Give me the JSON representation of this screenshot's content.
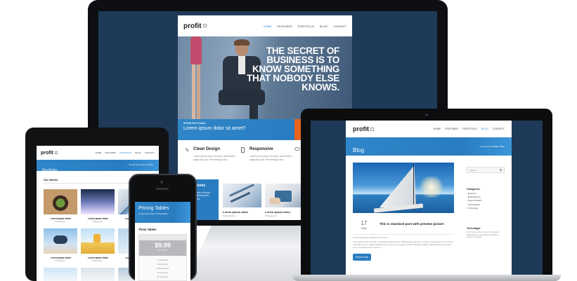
{
  "colors": {
    "accent": "#2a8ad8",
    "band": "#2f86c8",
    "orange": "#e8641e",
    "frame": "#0d0f12"
  },
  "monitor": {
    "logo": "profit",
    "nav": [
      "HOME",
      "FEATURES",
      "PORTFOLIO",
      "BLOG",
      "CONTACT"
    ],
    "hero_lines": [
      "THE SECRET OF",
      "BUSINESS IS TO",
      "KNOW SOMETHING",
      "THAT NOBODY ELSE",
      "KNOWS."
    ],
    "band_small": "IPSUM FACTIONAL",
    "band_text": "Lorem ipsum dolor sit amet?",
    "features": [
      {
        "icon": "pencil-icon",
        "title": "Clean Design",
        "text": "Lorem ipsum dolor sit amet, consectetur adipiscing elit. Pellentesque sed"
      },
      {
        "icon": "phone-outline-icon",
        "title": "Responsive",
        "text": "Lorem ipsum dolor sit amet, consectetur adipiscing elit. Pellentesque sed"
      }
    ],
    "recent_works": {
      "title": "Recent Works",
      "text": "Lorem ipsum dolor sit amet, consectetur adipiscing elit. Pellentesque sed"
    },
    "works": [
      {
        "caption": "Lorem Ipsum dolor",
        "sub": "Photography"
      },
      {
        "caption": "Lorem Ipsum dolor",
        "sub": "Photography"
      }
    ]
  },
  "tablet": {
    "logo": "profit",
    "nav": [
      "HOME",
      "FEATURES",
      "PORTFOLIO",
      "BLOG",
      "CONTACT"
    ],
    "band_title": "Portfolio",
    "breadcrumb": "You are here: Home / Portfolio",
    "section": "Our Works",
    "items": [
      {
        "caption": "Lorem ipsum dolor",
        "sub": "Photography"
      },
      {
        "caption": "Lorem ipsum dolor",
        "sub": "Photography"
      },
      {
        "caption": "Lorem ipsum dolor",
        "sub": "Photography"
      },
      {
        "caption": "Lorem ipsum dolor",
        "sub": "Photography"
      },
      {
        "caption": "Lorem ipsum dolor",
        "sub": "Photography"
      },
      {
        "caption": "Lorem ipsum dolor",
        "sub": "Photography"
      }
    ]
  },
  "phone": {
    "band_title": "Pricing Tables",
    "breadcrumb": "You are here: Home / Pricing Tables",
    "section": "Three Tables",
    "price": "$9.99",
    "price_sub": "per month",
    "features": [
      "1 GB Storage",
      "Free Domain",
      "Unlimited users",
      "Free Support",
      "No Setup Fee"
    ]
  },
  "laptop": {
    "logo": "profit",
    "nav": [
      "HOME",
      "FEATURES",
      "PORTFOLIO",
      "BLOG",
      "CONTACT"
    ],
    "band_title": "Blog",
    "breadcrumb_prefix": "You are here:",
    "breadcrumb_home": "Home",
    "breadcrumb_page": "Blog",
    "post": {
      "day": "17",
      "month": "May",
      "title": "This is standard post with preview picture",
      "meta": "by admin   Branding, Illustration   2 comments",
      "excerpt": "Lorem ipsum dolor sit amet, consectetur adipiscing elit. Pellentesque sed diam a pretium consequat ac at mi. Donec vulputate lorem ut magna egestas auctor. Aenean vel augue et felis consequat fringilla. Vivamus placerat suscipit sem, sed suscipit felis congue a.",
      "button": "Read more"
    },
    "search_placeholder": "Search...",
    "categories_title": "Categories",
    "categories": [
      "Business",
      "Entertainment",
      "News & Politics",
      "Social Media",
      "Technology"
    ],
    "text_widget_title": "Text widget",
    "text_widget": "Lorem ipsum dolor sit amet, consectetur adipiscing elit. Pellentesque sed diam a pretium consequat."
  }
}
